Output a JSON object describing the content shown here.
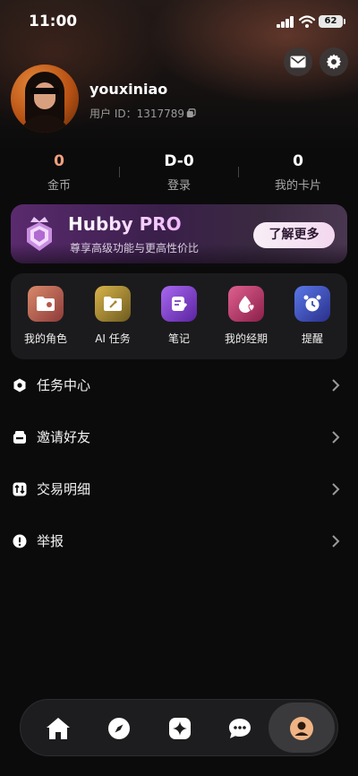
{
  "status": {
    "time": "11:00",
    "battery": "62"
  },
  "header": {
    "mail_icon": "mail-icon",
    "settings_icon": "gear-icon"
  },
  "profile": {
    "username": "youxiniao",
    "user_id": "用户 ID：1317789"
  },
  "stats": [
    {
      "value": "0",
      "label": "金币",
      "color": "#f1a07e"
    },
    {
      "value": "D-0",
      "label": "登录",
      "color": "#ffffff"
    },
    {
      "value": "0",
      "label": "我的卡片",
      "color": "#ffffff"
    }
  ],
  "banner": {
    "title": "Hubby PRO",
    "subtitle": "尊享高级功能与更高性价比",
    "button": "了解更多"
  },
  "quick_actions": [
    {
      "label": "我的角色",
      "icon": "role-folder-icon",
      "color": "#b85a4a"
    },
    {
      "label": "AI 任务",
      "icon": "ai-task-icon",
      "color": "#b08a2a"
    },
    {
      "label": "笔记",
      "icon": "note-icon",
      "color": "#7a3fc0"
    },
    {
      "label": "我的经期",
      "icon": "period-drop-icon",
      "color": "#c03a6a"
    },
    {
      "label": "提醒",
      "icon": "alarm-clock-icon",
      "color": "#3a4fb0"
    }
  ],
  "menu": [
    {
      "label": "任务中心",
      "icon": "task-center-icon"
    },
    {
      "label": "邀请好友",
      "icon": "invite-gift-icon"
    },
    {
      "label": "交易明细",
      "icon": "transactions-icon"
    },
    {
      "label": "举报",
      "icon": "report-icon"
    }
  ],
  "tabs": [
    "home-icon",
    "compass-icon",
    "sparkle-icon",
    "chat-icon",
    "profile-icon"
  ]
}
